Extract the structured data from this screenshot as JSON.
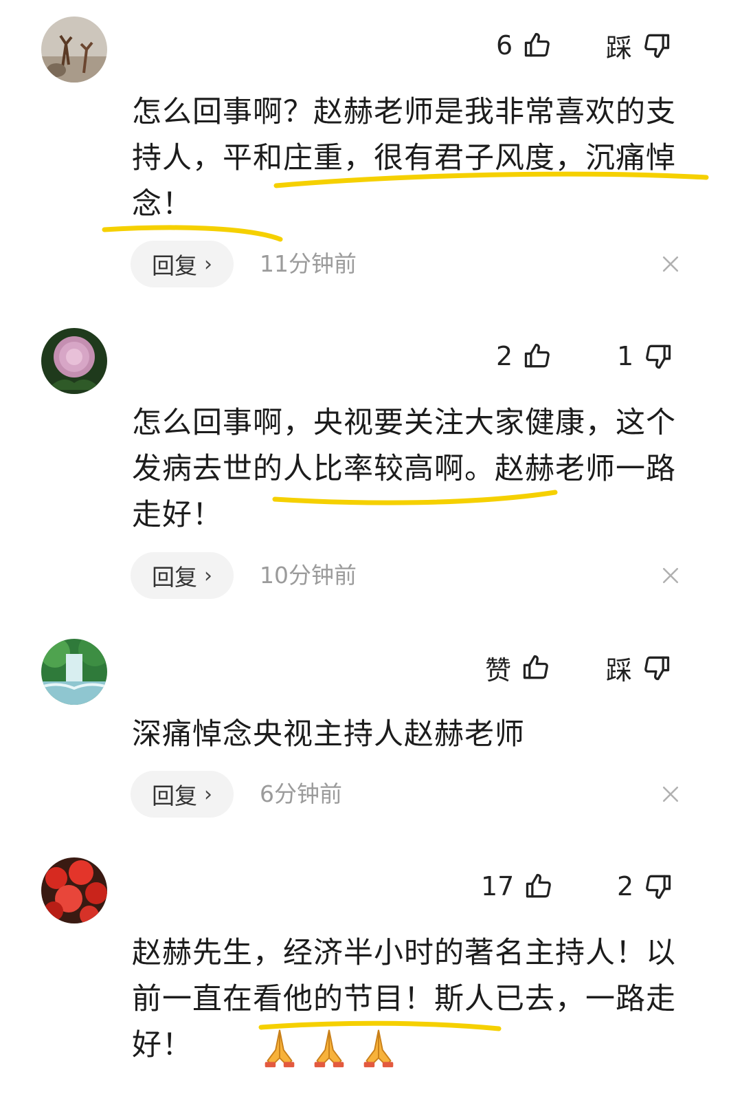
{
  "comments": [
    {
      "likes": "6",
      "dislike_label": "踩",
      "text": "怎么回事啊？赵赫老师是我非常喜欢的支持人，平和庄重，很有君子风度，沉痛悼念！",
      "reply_label": "回复",
      "time": "11分钟前"
    },
    {
      "likes": "2",
      "dislike_label": "1",
      "text": "怎么回事啊，央视要关注大家健康，这个发病去世的人比率较高啊。赵赫老师一路走好！",
      "reply_label": "回复",
      "time": "10分钟前"
    },
    {
      "likes": "赞",
      "dislike_label": "踩",
      "text": "深痛悼念央视主持人赵赫老师",
      "reply_label": "回复",
      "time": "6分钟前"
    },
    {
      "likes": "17",
      "dislike_label": "2",
      "text": "赵赫先生，经济半小时的著名主持人！以前一直在看他的节目！斯人已去，一路走好！",
      "reply_label": "回复",
      "time": ""
    }
  ],
  "icons": {
    "like": "thumbs-up-icon",
    "dislike": "thumbs-down-icon",
    "chevron": "chevron-right-icon",
    "close": "close-icon",
    "emoji": "folded-hands-icon"
  },
  "colors": {
    "highlight_underline": "#f5d000",
    "timestamp": "#9b9b9b",
    "pill_background": "#f3f3f3"
  }
}
